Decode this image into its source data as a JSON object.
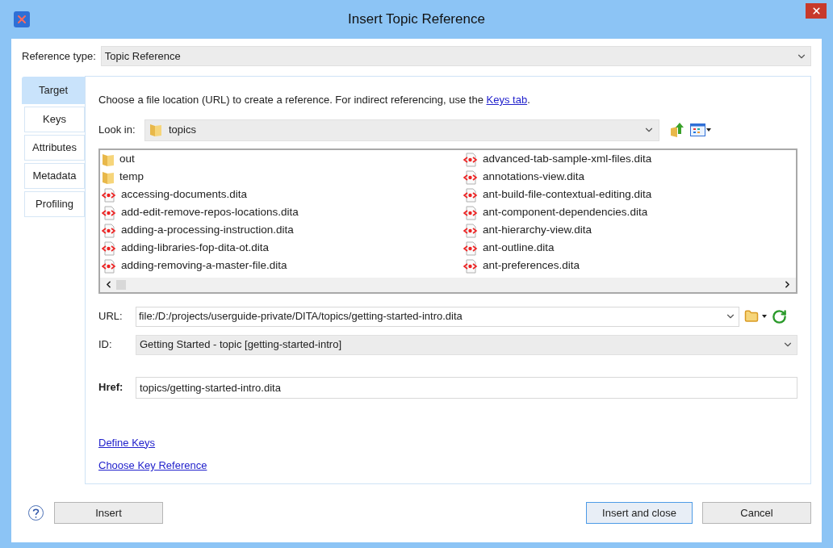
{
  "window": {
    "title": "Insert Topic Reference"
  },
  "reference_type": {
    "label": "Reference type:",
    "value": "Topic Reference"
  },
  "tabs": [
    {
      "label": "Target",
      "selected": true
    },
    {
      "label": "Keys",
      "selected": false
    },
    {
      "label": "Attributes",
      "selected": false
    },
    {
      "label": "Metadata",
      "selected": false
    },
    {
      "label": "Profiling",
      "selected": false
    }
  ],
  "intro": {
    "before": "Choose a file location (URL) to create a reference. For indirect referencing, use the ",
    "link": "Keys tab",
    "after": "."
  },
  "look_in": {
    "label": "Look in:",
    "value": "topics"
  },
  "files": [
    {
      "name": "out",
      "kind": "folder"
    },
    {
      "name": "temp",
      "kind": "folder"
    },
    {
      "name": "accessing-documents.dita",
      "kind": "dita"
    },
    {
      "name": "add-edit-remove-repos-locations.dita",
      "kind": "dita"
    },
    {
      "name": "adding-a-processing-instruction.dita",
      "kind": "dita"
    },
    {
      "name": "adding-libraries-fop-dita-ot.dita",
      "kind": "dita"
    },
    {
      "name": "adding-removing-a-master-file.dita",
      "kind": "dita"
    },
    {
      "name": "advanced-tab-sample-xml-files.dita",
      "kind": "dita"
    },
    {
      "name": "annotations-view.dita",
      "kind": "dita"
    },
    {
      "name": "ant-build-file-contextual-editing.dita",
      "kind": "dita"
    },
    {
      "name": "ant-component-dependencies.dita",
      "kind": "dita"
    },
    {
      "name": "ant-hierarchy-view.dita",
      "kind": "dita"
    },
    {
      "name": "ant-outline.dita",
      "kind": "dita"
    },
    {
      "name": "ant-preferences.dita",
      "kind": "dita"
    }
  ],
  "url": {
    "label": "URL:",
    "value": "file:/D:/projects/userguide-private/DITA/topics/getting-started-intro.dita"
  },
  "id": {
    "label": "ID:",
    "value": "Getting Started - topic [getting-started-intro]"
  },
  "href": {
    "label": "Href:",
    "value": "topics/getting-started-intro.dita"
  },
  "links": [
    "Define Keys",
    "Choose Key Reference"
  ],
  "buttons": [
    {
      "label": "Insert",
      "kind": "secondary"
    },
    {
      "label": "Insert and close",
      "kind": "default"
    },
    {
      "label": "Cancel",
      "kind": "secondary"
    }
  ]
}
